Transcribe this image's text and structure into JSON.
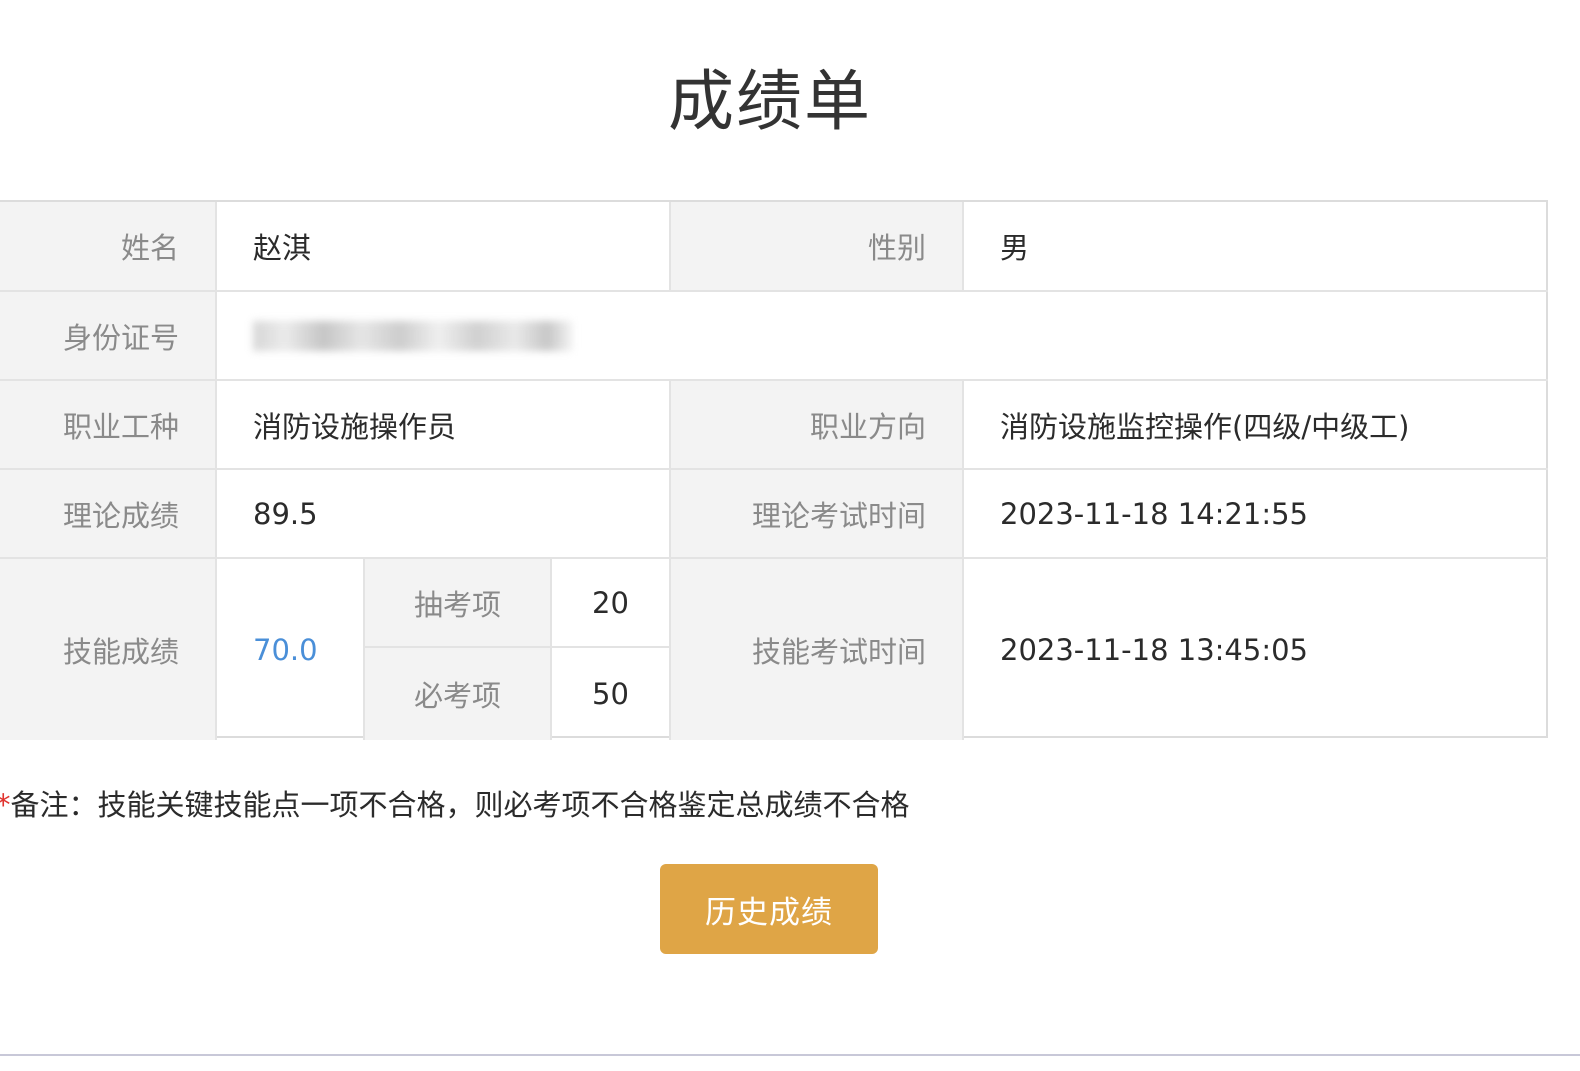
{
  "header": {
    "title": "成绩单"
  },
  "form": {
    "name_label": "姓名",
    "name_value": "赵淇",
    "gender_label": "性别",
    "gender_value": "男",
    "id_label": "身份证号",
    "occupation_label": "职业工种",
    "occupation_value": "消防设施操作员",
    "direction_label": "职业方向",
    "direction_value": "消防设施监控操作(四级/中级工)",
    "theory_score_label": "理论成绩",
    "theory_score_value": "89.5",
    "theory_time_label": "理论考试时间",
    "theory_time_value": "2023-11-18 14:21:55",
    "skill_score_label": "技能成绩",
    "skill_score_value": "70.0",
    "random_item_label": "抽考项",
    "random_item_value": "20",
    "required_item_label": "必考项",
    "required_item_value": "50",
    "skill_time_label": "技能考试时间",
    "skill_time_value": "2023-11-18 13:45:05"
  },
  "note": {
    "star": "*",
    "text": "备注：技能关键技能点一项不合格，则必考项不合格鉴定总成绩不合格"
  },
  "actions": {
    "history_button": "历史成绩"
  },
  "colors": {
    "accent_button": "#dfa546",
    "link_value": "#4a8fd8",
    "required_star": "#e0342f",
    "label_bg": "#f3f3f3"
  }
}
